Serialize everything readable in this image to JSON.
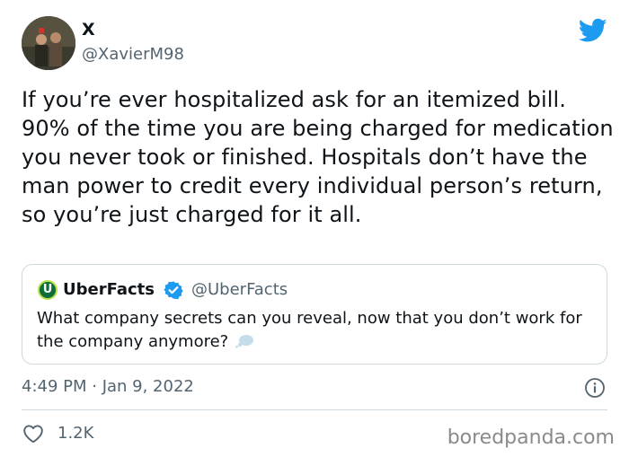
{
  "tweet": {
    "display_name": "X",
    "handle": "@XavierM98",
    "text": "If you’re ever hospitalized ask for an itemized bill. 90% of the time you are being charged for medication you never took or finished. Hospitals don’t have the man power to credit every individual person’s return, so you’re just charged for it all.",
    "timestamp": "4:49 PM · Jan 9, 2022",
    "like_count": "1.2K"
  },
  "quote": {
    "avatar_letter": "U",
    "name": "UberFacts",
    "handle": "@UberFacts",
    "text": "What company secrets can you reveal, now that you don’t work for the company anymore?"
  },
  "watermark": "boredpanda.com",
  "icons": {
    "logo": "twitter-bird-icon",
    "verified": "verified-badge-icon",
    "thought": "thought-bubble-icon",
    "info": "info-icon",
    "like": "heart-icon"
  },
  "colors": {
    "twitter_blue": "#1d9bf0",
    "text": "#0f1419",
    "secondary_text": "#536471",
    "border": "#cfd9de"
  }
}
